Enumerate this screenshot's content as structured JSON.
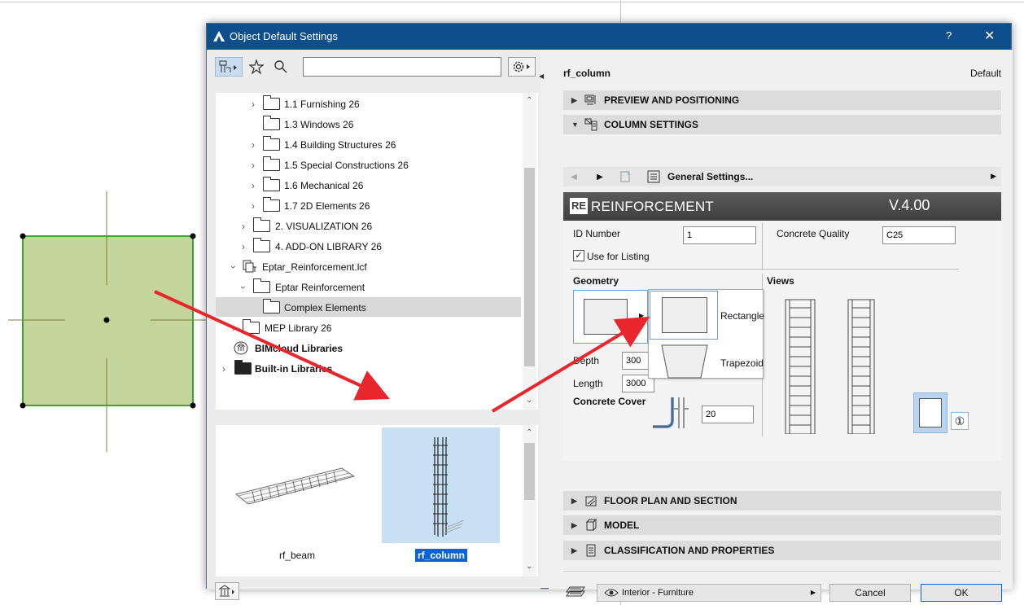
{
  "window": {
    "title": "Object Default Settings",
    "help": "?",
    "close": "✕"
  },
  "library": {
    "search_placeholder": "",
    "tree": [
      {
        "label": "1.1 Furnishing 26"
      },
      {
        "label": "1.3 Windows 26"
      },
      {
        "label": "1.4 Building Structures 26"
      },
      {
        "label": "1.5 Special Constructions 26"
      },
      {
        "label": "1.6 Mechanical 26"
      },
      {
        "label": "1.7 2D Elements 26"
      },
      {
        "label": "2. VISUALIZATION 26"
      },
      {
        "label": "4. ADD-ON LIBRARY 26"
      },
      {
        "label": "Eptar_Reinforcement.lcf"
      },
      {
        "label": "Eptar Reinforcement"
      },
      {
        "label": "Complex Elements"
      },
      {
        "label": "MEP Library 26"
      },
      {
        "label": "BIMcloud Libraries"
      },
      {
        "label": "Built-in Libraries"
      }
    ],
    "previews": [
      {
        "label": "rf_beam"
      },
      {
        "label": "rf_column"
      }
    ]
  },
  "settings": {
    "object_name": "rf_column",
    "default_label": "Default",
    "sections": {
      "preview": "PREVIEW AND POSITIONING",
      "column": "COLUMN SETTINGS",
      "floor_plan": "FLOOR PLAN AND SECTION",
      "model": "MODEL",
      "classification": "CLASSIFICATION AND PROPERTIES"
    },
    "general_settings": "General Settings...",
    "gdl": {
      "logo_text": "RE",
      "title": "REINFORCEMENT",
      "version": "V.4.00",
      "id_number_label": "ID Number",
      "id_number_value": "1",
      "concrete_quality_label": "Concrete Quality",
      "concrete_quality_value": "C25",
      "use_for_listing_label": "Use for Listing",
      "use_for_listing_checked": true,
      "geometry_label": "Geometry",
      "views_label": "Views",
      "depth_label": "Depth",
      "depth_value": "300",
      "length_label": "Length",
      "length_value": "3000",
      "concrete_cover_label": "Concrete Cover",
      "concrete_cover_value": "20",
      "view_number": "①",
      "shape_options": [
        "Rectangle",
        "Trapezoid"
      ]
    },
    "layer": "Interior - Furniture",
    "cancel_label": "Cancel",
    "ok_label": "OK"
  },
  "colors": {
    "titlebar": "#0e4e8c",
    "selection": "#0a64d6",
    "arrow": "#e8262b",
    "element_fill": "#c3d59b",
    "element_stroke": "#3aa534"
  }
}
